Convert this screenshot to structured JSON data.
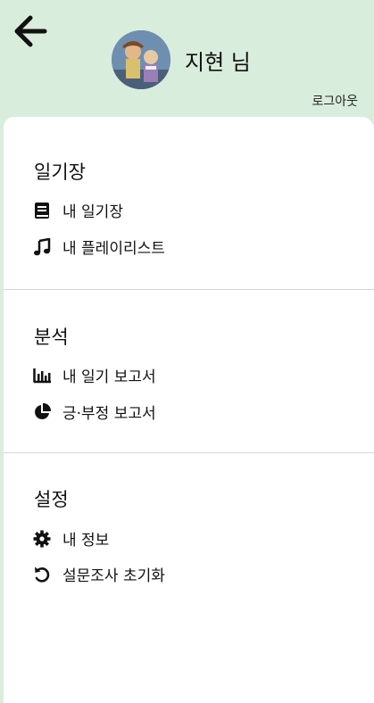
{
  "header": {
    "user_name": "지현 님",
    "logout_label": "로그아웃"
  },
  "sections": [
    {
      "title": "일기장",
      "items": [
        {
          "label": "내 일기장",
          "icon": "book-icon"
        },
        {
          "label": "내 플레이리스트",
          "icon": "music-note-icon"
        }
      ]
    },
    {
      "title": "분석",
      "items": [
        {
          "label": "내 일기 보고서",
          "icon": "bar-chart-icon"
        },
        {
          "label": "긍·부정 보고서",
          "icon": "pie-chart-icon"
        }
      ]
    },
    {
      "title": "설정",
      "items": [
        {
          "label": "내 정보",
          "icon": "gear-icon"
        },
        {
          "label": "설문조사 초기화",
          "icon": "reset-icon"
        }
      ]
    }
  ],
  "colors": {
    "header_bg": "#d9eddc",
    "panel_bg": "#ffffff"
  }
}
